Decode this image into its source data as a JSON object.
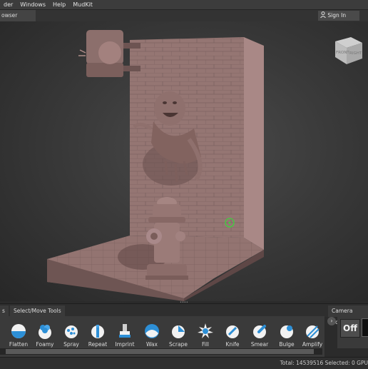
{
  "menu": {
    "items": [
      "der",
      "Windows",
      "Help",
      "MudKit"
    ]
  },
  "tabs": {
    "browser_label": "owser",
    "sign_in_label": "Sign In"
  },
  "viewcube": {
    "front_label": "FRONT",
    "right_label": "RIGHT"
  },
  "bottom_tabs": {
    "left_partial": "s",
    "select_move": "Select/Move Tools",
    "camera_bookmarks": "Camera Bookma"
  },
  "tools": [
    {
      "label": "Flatten",
      "icon": "flatten-icon"
    },
    {
      "label": "Foamy",
      "icon": "foamy-icon"
    },
    {
      "label": "Spray",
      "icon": "spray-icon"
    },
    {
      "label": "Repeat",
      "icon": "repeat-icon"
    },
    {
      "label": "Imprint",
      "icon": "imprint-icon"
    },
    {
      "label": "Wax",
      "icon": "wax-icon"
    },
    {
      "label": "Scrape",
      "icon": "scrape-icon"
    },
    {
      "label": "Fill",
      "icon": "fill-icon"
    },
    {
      "label": "Knife",
      "icon": "knife-icon"
    },
    {
      "label": "Smear",
      "icon": "smear-icon"
    },
    {
      "label": "Bulge",
      "icon": "bulge-icon"
    },
    {
      "label": "Amplify",
      "icon": "amplify-icon"
    }
  ],
  "camera": {
    "off_label": "Off"
  },
  "status": {
    "text": "Total: 14539516  Selected: 0 GPU"
  },
  "colors": {
    "clay": "#9a7b78",
    "clay_dark": "#6e5553",
    "accent_blue": "#2d8fd6",
    "viewport_bg": "#3a3a3a"
  }
}
